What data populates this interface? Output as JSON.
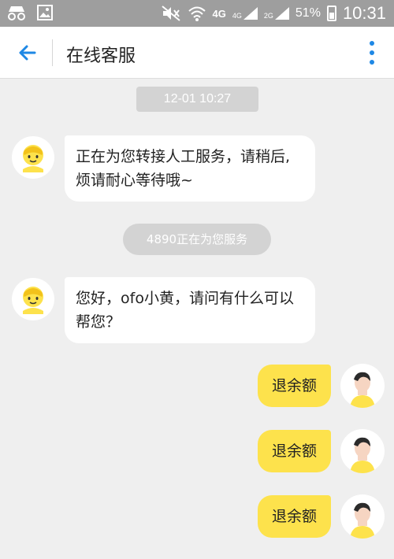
{
  "status_bar": {
    "network_4g": "4G",
    "signal_1_label": "4G",
    "signal_2_label": "2G",
    "battery": "51%",
    "time": "10:31"
  },
  "header": {
    "title": "在线客服"
  },
  "chat": {
    "timestamp": "12-01 10:27",
    "system_notice": "4890正在为您服务",
    "messages": [
      {
        "from": "agent",
        "text": "正在为您转接人工服务，请稍后,烦请耐心等待哦~"
      },
      {
        "from": "agent",
        "text": "您好，ofo小黄，请问有什么可以帮您？"
      },
      {
        "from": "user",
        "text": "退余额"
      },
      {
        "from": "user",
        "text": "退余额"
      },
      {
        "from": "user",
        "text": "退余额"
      }
    ]
  },
  "colors": {
    "status_bar": "#9e9e9e",
    "accent": "#1e88e5",
    "user_bubble": "#fde24c",
    "background": "#efefef"
  }
}
